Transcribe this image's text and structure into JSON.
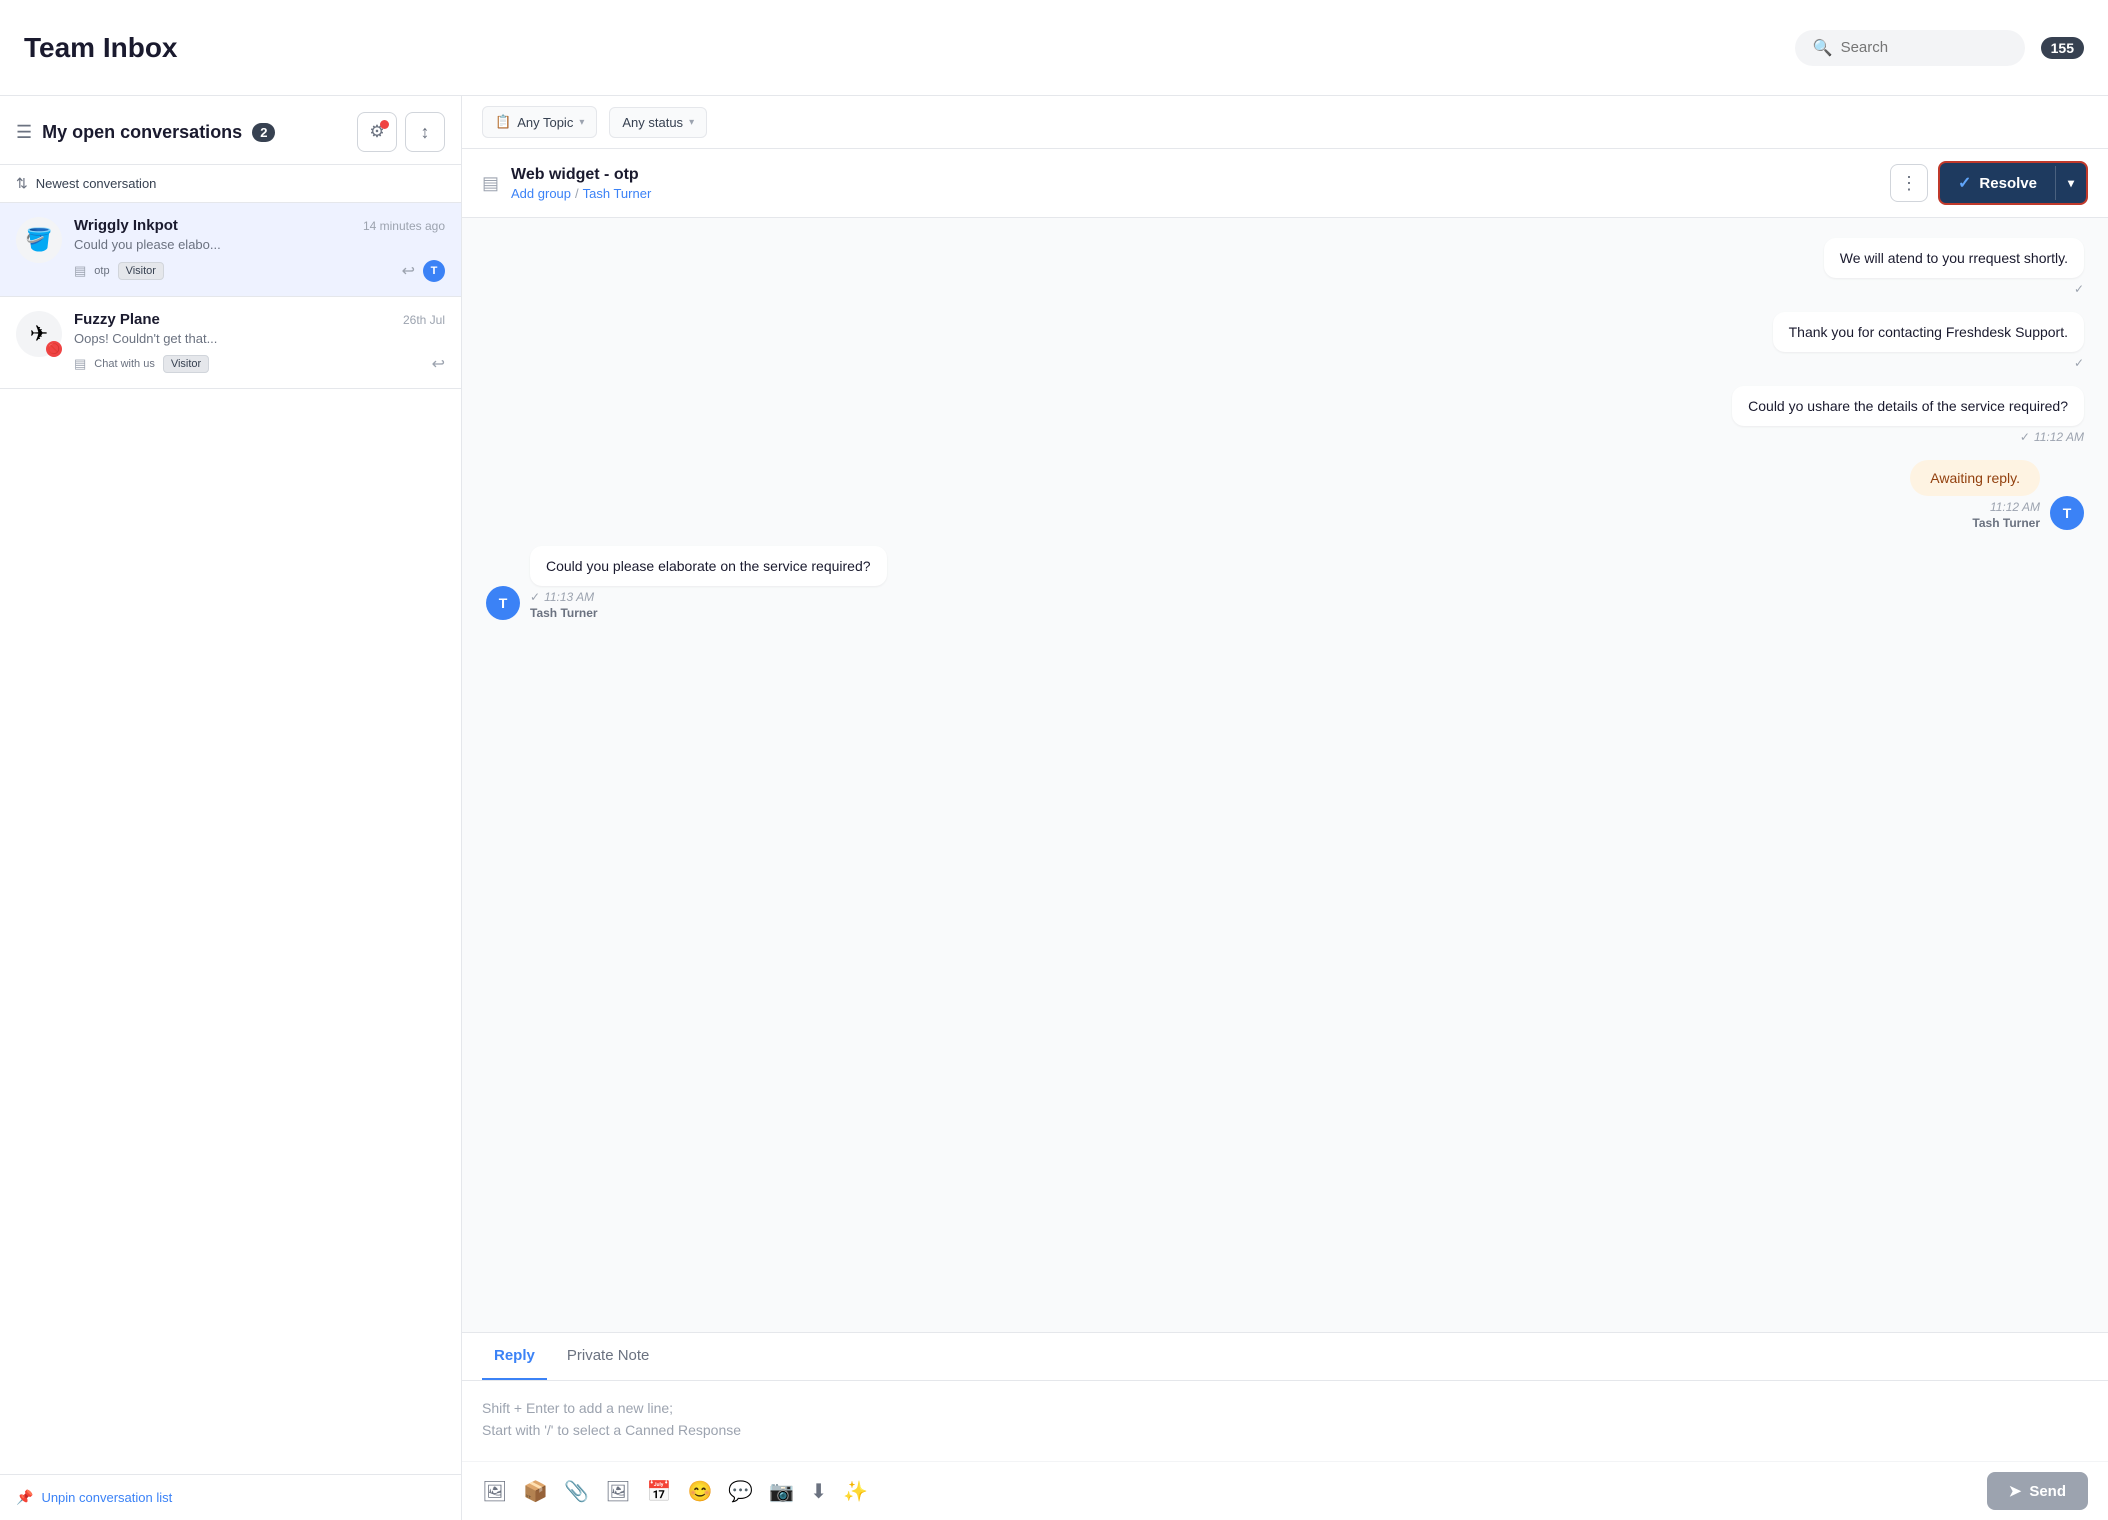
{
  "header": {
    "title": "Team Inbox",
    "search_placeholder": "Search",
    "badge_count": "155"
  },
  "sidebar": {
    "inbox_label": "My open conversations",
    "inbox_count": "2",
    "sort_label": "Newest conversation",
    "unpin_label": "Unpin conversation list"
  },
  "conversations": [
    {
      "id": "conv1",
      "name": "Wriggly Inkpot",
      "time": "14 minutes ago",
      "preview": "Could you please elabo...",
      "tag": "otp",
      "badge": "Visitor",
      "avatar_emoji": "🪣",
      "assignee_initial": "T",
      "active": true
    },
    {
      "id": "conv2",
      "name": "Fuzzy Plane",
      "time": "26th Jul",
      "preview": "Oops! Couldn't get that...",
      "tag": "Chat with us",
      "badge": "Visitor",
      "avatar_emoji": "✈",
      "active": false
    }
  ],
  "filters": {
    "topic": "Any Topic",
    "status": "Any status"
  },
  "chat": {
    "header_title": "Web widget - otp",
    "add_group": "Add group",
    "slash": "/",
    "assignee": "Tash Turner",
    "resolve_label": "Resolve",
    "more_options": "⋮"
  },
  "messages": [
    {
      "id": "msg1",
      "text": "We will atend to you rrequest shortly.",
      "side": "right",
      "time": "",
      "check": "✓",
      "sender": ""
    },
    {
      "id": "msg2",
      "text": "Thank you for contacting Freshdesk Support.",
      "side": "right",
      "time": "",
      "check": "✓",
      "sender": ""
    },
    {
      "id": "msg3",
      "text": "Could yo ushare the details of the service required?",
      "side": "right",
      "time": "11:12 AM",
      "check": "✓",
      "sender": ""
    },
    {
      "id": "msg4",
      "text": "Awaiting reply.",
      "side": "right",
      "type": "awaiting",
      "time": "11:12 AM",
      "sender": "Tash Turner",
      "avatar_initial": "T"
    },
    {
      "id": "msg5",
      "text": "Could you please elaborate on the service required?",
      "side": "left",
      "time": "11:13 AM",
      "check": "✓",
      "sender": "Tash Turner",
      "avatar_initial": "T"
    }
  ],
  "reply": {
    "tab_reply": "Reply",
    "tab_note": "Private Note",
    "placeholder_line1": "Shift + Enter to add a new line;",
    "placeholder_line2": "Start with '/' to select a Canned Response",
    "send_label": "Send"
  },
  "icons": {
    "search": "🔍",
    "filter": "⚙",
    "sort": "↕",
    "reply_arrow": "↩",
    "send": "➤",
    "check_icon": "✓",
    "chevron_down": "▾",
    "more": "⋮",
    "attachment": "📎",
    "image": "🖼",
    "emoji": "😊",
    "canned": "💬",
    "calendar": "📅",
    "instagram": "📷",
    "download": "⬇",
    "ai": "✨",
    "topic_icon": "📋",
    "widget_icon": "📋"
  }
}
